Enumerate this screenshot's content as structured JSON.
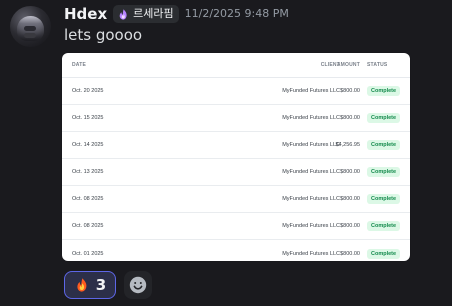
{
  "message": {
    "author": "Hdex",
    "tag_label": "르세라핌",
    "timestamp": "11/2/2025 9:48 PM",
    "content": "lets goooo"
  },
  "embed": {
    "table": {
      "columns": {
        "date": "DATE",
        "client": "CLIENT",
        "amount": "AMOUNT",
        "status": "STATUS"
      },
      "rows": [
        {
          "date": "Oct. 20 2025",
          "client": "MyFunded Futures LLC",
          "amount": "$800.00",
          "status": "Complete"
        },
        {
          "date": "Oct. 15 2025",
          "client": "MyFunded Futures LLC",
          "amount": "$800.00",
          "status": "Complete"
        },
        {
          "date": "Oct. 14 2025",
          "client": "MyFunded Futures LLC",
          "amount": "$4,256.95",
          "status": "Complete"
        },
        {
          "date": "Oct. 13 2025",
          "client": "MyFunded Futures LLC",
          "amount": "$800.00",
          "status": "Complete"
        },
        {
          "date": "Oct. 08 2025",
          "client": "MyFunded Futures LLC",
          "amount": "$800.00",
          "status": "Complete"
        },
        {
          "date": "Oct. 08 2025",
          "client": "MyFunded Futures LLC",
          "amount": "$800.00",
          "status": "Complete"
        },
        {
          "date": "Oct. 01 2025",
          "client": "MyFunded Futures LLC",
          "amount": "$800.00",
          "status": "Complete"
        }
      ]
    }
  },
  "reactions": [
    {
      "emoji_name": "fire-icon",
      "count": "3"
    }
  ],
  "icons": {
    "avatar": "avatar-image",
    "tag": "purple-flame-icon",
    "add_reaction": "smiley-icon"
  },
  "colors": {
    "background": "#1a1a1e",
    "tag_background": "#2b2d31",
    "reaction_border": "#5d66e7",
    "reaction_background": "#2c2f49",
    "status_background": "#dcf8e6",
    "status_text": "#138a4c"
  }
}
